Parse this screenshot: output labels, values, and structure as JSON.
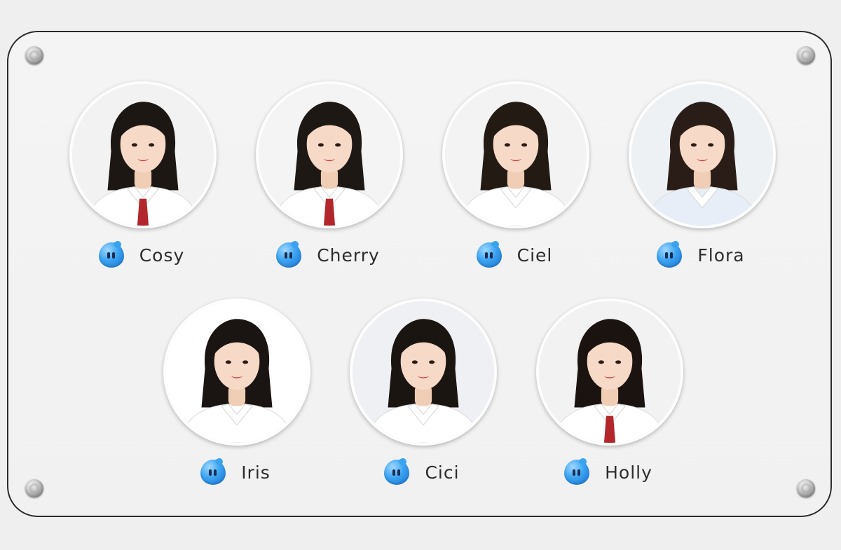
{
  "team": {
    "members": [
      {
        "name": "Cosy",
        "icon": "blue-droplet-icon",
        "shirt": "#ffffff",
        "hair": "#1d1714",
        "tie": "#b3262b",
        "bg": "#f2f2f2"
      },
      {
        "name": "Cherry",
        "icon": "blue-droplet-icon",
        "shirt": "#ffffff",
        "hair": "#1e1814",
        "tie": "#b3262b",
        "bg": "#f4f4f4"
      },
      {
        "name": "Ciel",
        "icon": "blue-droplet-icon",
        "shirt": "#ffffff",
        "hair": "#231a14",
        "tie": "",
        "bg": "#f3f3f3"
      },
      {
        "name": "Flora",
        "icon": "blue-droplet-icon",
        "shirt": "#e7eef8",
        "hair": "#2a1d17",
        "tie": "",
        "bg": "#eef1f4"
      },
      {
        "name": "Iris",
        "icon": "blue-droplet-icon",
        "shirt": "#ffffff",
        "hair": "#1a1412",
        "tie": "",
        "bg": "#ffffff"
      },
      {
        "name": "Cici",
        "icon": "blue-droplet-icon",
        "shirt": "#ffffff",
        "hair": "#1b1512",
        "tie": "",
        "bg": "#eef0f4"
      },
      {
        "name": "Holly",
        "icon": "blue-droplet-icon",
        "shirt": "#ffffff",
        "hair": "#1b1310",
        "tie": "#b3262b",
        "bg": "#f2f2f2"
      }
    ]
  },
  "colors": {
    "accent_icon": "#3aa3f0",
    "frame_border": "#2a2a2a",
    "text": "#2c2c2c"
  }
}
